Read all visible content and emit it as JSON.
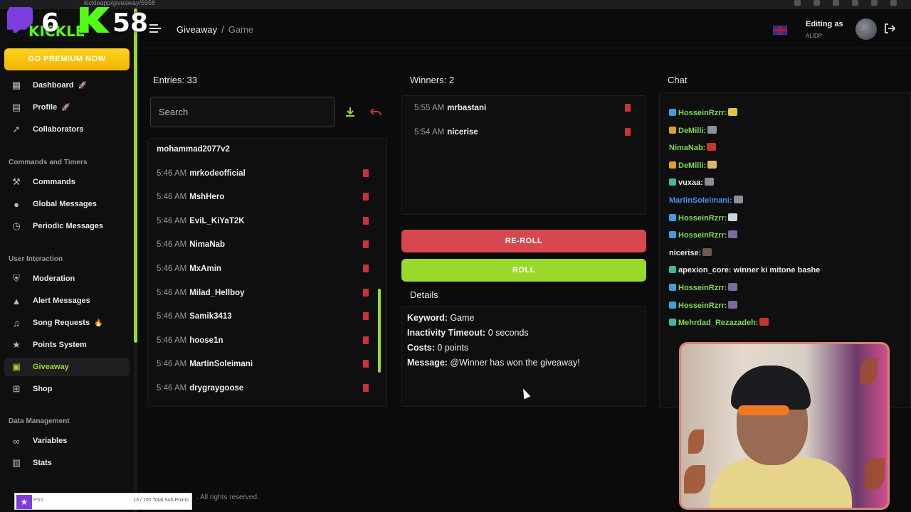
{
  "browser": {
    "url": "kickleapp/giveaway/5958"
  },
  "overlay": {
    "count_left": "6",
    "count_right": "58",
    "brand": "KICKLE"
  },
  "sidebar": {
    "premium_label": "GO PREMIUM NOW",
    "items_top": [
      {
        "label": "Dashboard",
        "icon": "dashboard-icon",
        "emoji": "🚀"
      },
      {
        "label": "Profile",
        "icon": "clipboard-icon",
        "emoji": "🚀"
      },
      {
        "label": "Collaborators",
        "icon": "rocket-icon",
        "emoji": ""
      }
    ],
    "section_commands": "Commands and Timers",
    "items_commands": [
      {
        "label": "Commands",
        "icon": "wrench-icon"
      },
      {
        "label": "Global Messages",
        "icon": "chat-icon"
      },
      {
        "label": "Periodic Messages",
        "icon": "clock-icon"
      }
    ],
    "section_user": "User Interaction",
    "items_user": [
      {
        "label": "Moderation",
        "icon": "shield-icon",
        "emoji": ""
      },
      {
        "label": "Alert Messages",
        "icon": "warning-icon",
        "emoji": ""
      },
      {
        "label": "Song Requests",
        "icon": "music-icon",
        "emoji": "🔥"
      },
      {
        "label": "Points System",
        "icon": "star-icon",
        "emoji": ""
      },
      {
        "label": "Giveaway",
        "icon": "gift-icon",
        "emoji": ""
      },
      {
        "label": "Shop",
        "icon": "cart-icon",
        "emoji": ""
      }
    ],
    "section_data": "Data Management",
    "items_data": [
      {
        "label": "Variables",
        "icon": "link-icon"
      },
      {
        "label": "Stats",
        "icon": "bar-chart-icon"
      }
    ],
    "active_item": "Giveaway",
    "accent_color": "#9ad92a",
    "premium_color": "#f5c000"
  },
  "header": {
    "breadcrumb_1": "Giveaway",
    "breadcrumb_sep": "/",
    "breadcrumb_2": "Game",
    "editing_label": "Editing as",
    "editing_user": "ALIDP"
  },
  "entries": {
    "title": "Entries: 33",
    "search_placeholder": "Search",
    "rows": [
      {
        "time": "",
        "user": "mohammad2077v2"
      },
      {
        "time": "5:46 AM",
        "user": "mrkodeofficial"
      },
      {
        "time": "5:46 AM",
        "user": "MshHero"
      },
      {
        "time": "5:46 AM",
        "user": "EviL_KiYaT2K"
      },
      {
        "time": "5:46 AM",
        "user": "NimaNab"
      },
      {
        "time": "5:46 AM",
        "user": "MxAmin"
      },
      {
        "time": "5:46 AM",
        "user": "Milad_Hellboy"
      },
      {
        "time": "5:46 AM",
        "user": "Samik3413"
      },
      {
        "time": "5:46 AM",
        "user": "hoose1n"
      },
      {
        "time": "5:46 AM",
        "user": "MartinSoleimani"
      },
      {
        "time": "5:46 AM",
        "user": "drygraygoose"
      }
    ]
  },
  "winners": {
    "title": "Winners: 2",
    "rows": [
      {
        "time": "5:55 AM",
        "user": "mrbastani"
      },
      {
        "time": "5:54 AM",
        "user": "nicerise"
      }
    ]
  },
  "actions": {
    "reroll_label": "RE-ROLL",
    "roll_label": "ROLL",
    "reroll_color": "#d9474e",
    "roll_color": "#9ad92a"
  },
  "details": {
    "title": "Details",
    "keyword_label": "Keyword:",
    "keyword_value": "Game",
    "timeout_label": "Inactivity Timeout:",
    "timeout_value": "0 seconds",
    "costs_label": "Costs:",
    "costs_value": "0 points",
    "message_label": "Message:",
    "message_value": "@Winner has won the giveaway!"
  },
  "chat": {
    "title": "Chat",
    "messages": [
      {
        "user": "HosseinRzrr:",
        "color": "#7ed957",
        "badge": "#3aa0e0",
        "text": "",
        "emote": "#e6c14a"
      },
      {
        "user": "DeMilli:",
        "color": "#7ed957",
        "badge": "#e0a020",
        "text": "",
        "emote": "#8a8f98"
      },
      {
        "user": "NimaNab:",
        "color": "#7ed957",
        "badge": "",
        "text": "",
        "emote": "#c0392b"
      },
      {
        "user": "DeMilli:",
        "color": "#7ed957",
        "badge": "#e0a020",
        "text": "",
        "emote": "#d9b86a"
      },
      {
        "user": "vuxaa:",
        "color": "#e8e8e8",
        "badge": "#3fb8a0",
        "text": "",
        "emote": "#8a8f98"
      },
      {
        "user": "MartinSoleimani:",
        "color": "#4a90e2",
        "badge": "",
        "text": "",
        "emote": "#8a8f98"
      },
      {
        "user": "HosseinRzrr:",
        "color": "#7ed957",
        "badge": "#3aa0e0",
        "text": "",
        "emote": "#cfd4da"
      },
      {
        "user": "HosseinRzrr:",
        "color": "#7ed957",
        "badge": "#3aa0e0",
        "text": "",
        "emote": "#7a6ba0"
      },
      {
        "user": "nicerise:",
        "color": "#e8e8e8",
        "badge": "",
        "text": "",
        "emote": "#6a5b55"
      },
      {
        "user": "apexion_core:",
        "color": "#e8e8e8",
        "badge": "#3fb8a0",
        "text": "winner ki mitone bashe",
        "emote": ""
      },
      {
        "user": "HosseinRzrr:",
        "color": "#7ed957",
        "badge": "#3aa0e0",
        "text": "",
        "emote": "#7a6ba0"
      },
      {
        "user": "HosseinRzrr:",
        "color": "#7ed957",
        "badge": "#3aa0e0",
        "text": "",
        "emote": "#7a6ba0"
      },
      {
        "user": "Mehrdad_Rezazadeh:",
        "color": "#7ed957",
        "badge": "#3fb8a0",
        "text": "",
        "emote": "#c0392b"
      }
    ]
  },
  "footer": {
    "text": ". All rights reserved."
  },
  "subbar": {
    "left": "PSS",
    "right": "13 / 100 Total Sub Points"
  }
}
